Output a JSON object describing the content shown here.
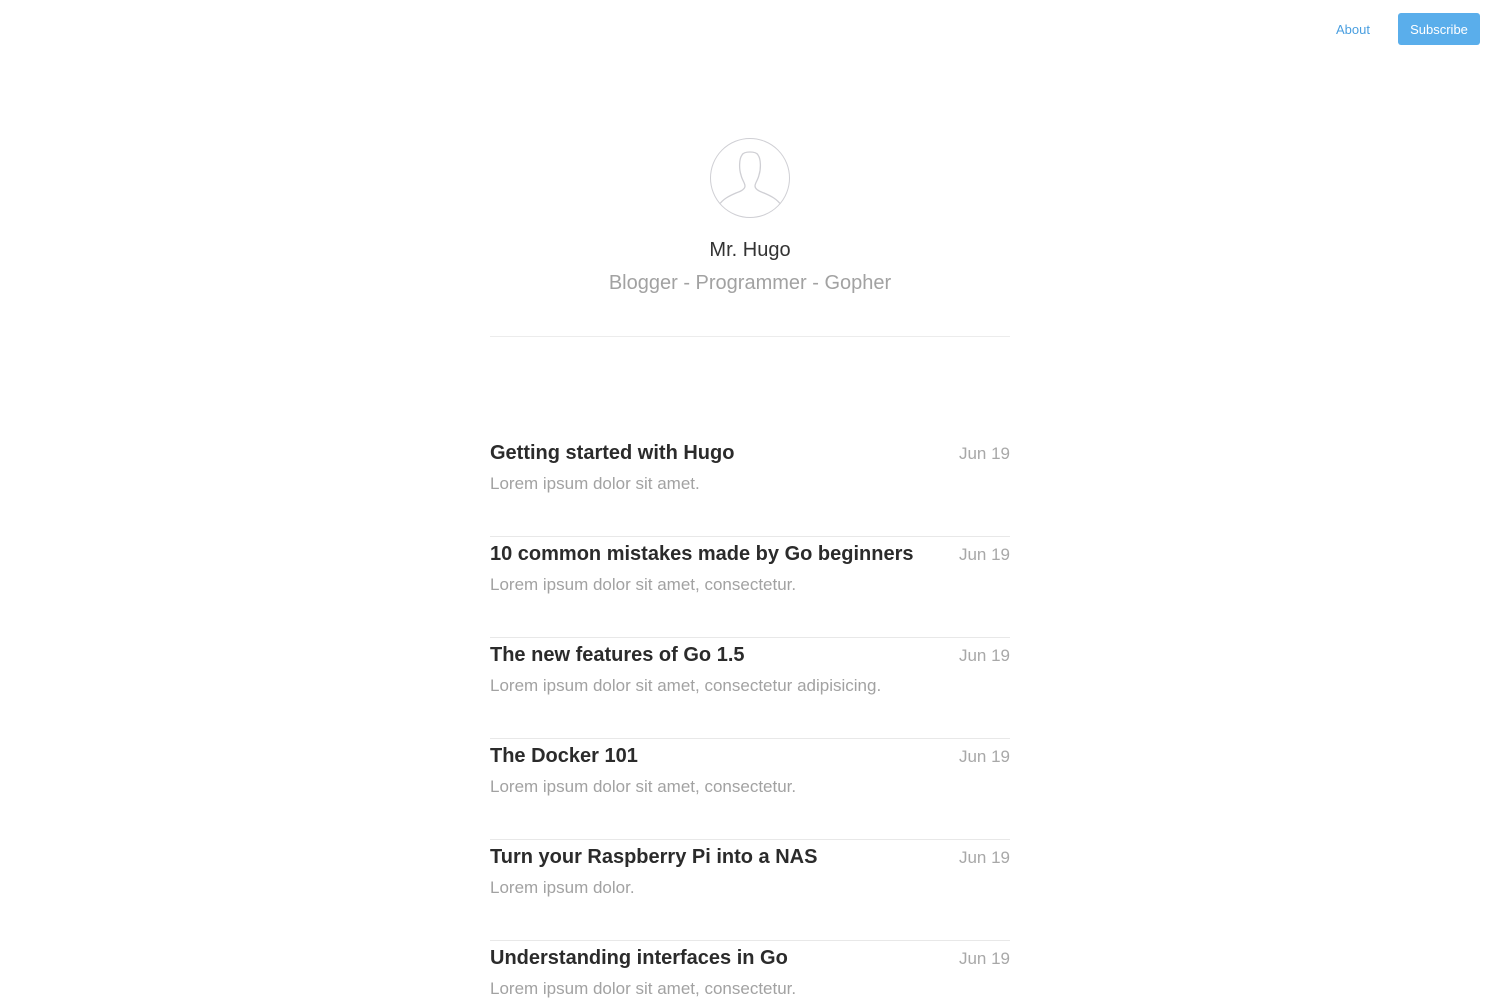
{
  "nav": {
    "about_label": "About",
    "subscribe_label": "Subscribe"
  },
  "profile": {
    "avatar_icon": "user-silhouette-icon",
    "name": "Mr. Hugo",
    "tagline": "Blogger - Programmer - Gopher"
  },
  "posts": [
    {
      "title": "Getting started with Hugo",
      "excerpt": "Lorem ipsum dolor sit amet.",
      "date": "Jun 19"
    },
    {
      "title": "10 common mistakes made by Go beginners",
      "excerpt": "Lorem ipsum dolor sit amet, consectetur.",
      "date": "Jun 19"
    },
    {
      "title": "The new features of Go 1.5",
      "excerpt": "Lorem ipsum dolor sit amet, consectetur adipisicing.",
      "date": "Jun 19"
    },
    {
      "title": "The Docker 101",
      "excerpt": "Lorem ipsum dolor sit amet, consectetur.",
      "date": "Jun 19"
    },
    {
      "title": "Turn your Raspberry Pi into a NAS",
      "excerpt": "Lorem ipsum dolor.",
      "date": "Jun 19"
    },
    {
      "title": "Understanding interfaces in Go",
      "excerpt": "Lorem ipsum dolor sit amet, consectetur.",
      "date": "Jun 19"
    }
  ],
  "colors": {
    "accent": "#5aaeeb",
    "link": "#4a9fe0",
    "title": "#2b2b2b",
    "muted": "#a2a2a2"
  }
}
